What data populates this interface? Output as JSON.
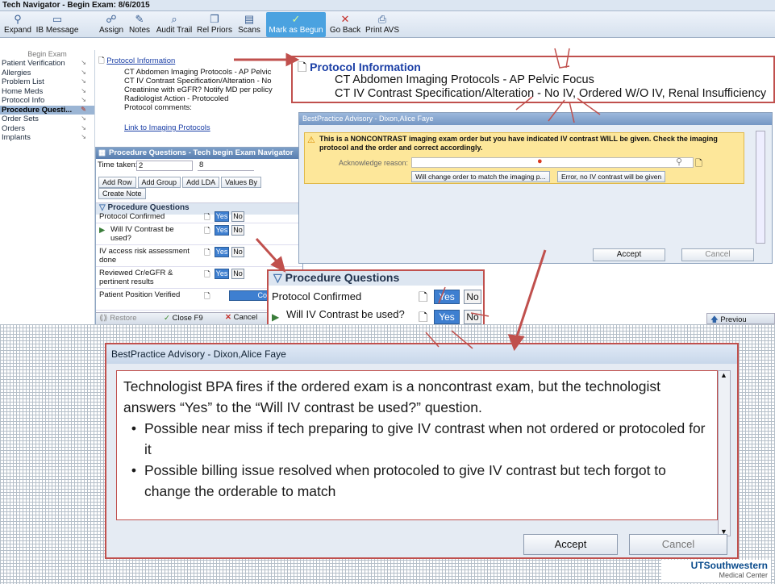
{
  "window": {
    "title": "Tech Navigator - Begin Exam: 8/6/2015"
  },
  "toolbar": {
    "items": [
      {
        "label": "Expand",
        "icon": "magnifier-icon"
      },
      {
        "label": "IB Message",
        "icon": "inbox-icon"
      },
      {
        "label": "Assign",
        "icon": "assign-icon"
      },
      {
        "label": "Notes",
        "icon": "notes-icon"
      },
      {
        "label": "Audit Trail",
        "icon": "audit-icon"
      },
      {
        "label": "Rel Priors",
        "icon": "priors-icon"
      },
      {
        "label": "Scans",
        "icon": "scan-icon"
      },
      {
        "label": "Mark as Begun",
        "icon": "check-icon"
      },
      {
        "label": "Go Back",
        "icon": "x-icon"
      },
      {
        "label": "Print AVS",
        "icon": "printer-icon"
      }
    ]
  },
  "leftnav": {
    "header": "Begin Exam",
    "items": [
      "Patient Verification",
      "Allergies",
      "Problem List",
      "Home Meds",
      "Protocol Info",
      "Procedure Questi...",
      "Order Sets",
      "Orders",
      "Implants"
    ],
    "selected_index": 5
  },
  "protocol": {
    "heading": "Protocol Information",
    "lines": [
      "CT Abdomen Imaging Protocols - AP Pelvic",
      "CT IV Contrast Specification/Alteration - No",
      "Creatinine with eGFR? Notify MD per policy",
      "Radiologist Action - Protocoled",
      "Protocol comments:"
    ],
    "link": "Link to Imaging Protocols"
  },
  "procpanel": {
    "title": "Procedure Questions - Tech begin Exam Navigator",
    "time_label": "Time taken:",
    "time_value_1": "2",
    "time_value_2": "8",
    "buttons": [
      "Add Row",
      "Add Group",
      "Add LDA",
      "Values By",
      "Create Note"
    ],
    "section": "Procedure Questions",
    "questions": [
      {
        "label": "Protocol Confirmed",
        "yes": "Yes",
        "no": "No"
      },
      {
        "label": "Will IV Contrast be used?",
        "yes": "Yes",
        "no": "No"
      },
      {
        "label": "IV access risk assessment done",
        "yes": "Yes",
        "no": "No"
      },
      {
        "label": "Reviewed Cr/eGFR & pertinent results",
        "yes": "Yes",
        "no": "No"
      },
      {
        "label": "Patient Position Verified",
        "extra": "Correct imag"
      }
    ],
    "footer": {
      "restore": "Restore",
      "close": "Close",
      "close_key": "F9",
      "cancel": "Cancel"
    }
  },
  "zoom_protocol": {
    "heading": "Protocol Information",
    "line1": "CT Abdomen Imaging Protocols - AP Pelvic Focus",
    "line2": "CT IV Contrast Specification/Alteration - No IV, Ordered W/O IV, Renal Insufficiency"
  },
  "bpa_small": {
    "title": "BestPractice Advisory - Dixon,Alice Faye",
    "message": "This is a NONCONTRAST imaging exam order but you have indicated IV contrast WILL be given. Check the imaging protocol and the order and correct accordingly.",
    "ack_label": "Acknowledge reason:",
    "option1": "Will change order to match the imaging p...",
    "option2": "Error, no IV contrast will be given",
    "accept": "Accept",
    "cancel": "Cancel"
  },
  "zoom_questions": {
    "section": "Procedure Questions",
    "q1": "Protocol Confirmed",
    "q2": "Will IV Contrast be used?",
    "yes": "Yes",
    "no": "No"
  },
  "previous_label": "Previou",
  "bpa_big": {
    "title": "BestPractice Advisory - Dixon,Alice Faye",
    "paragraph": "Technologist BPA fires if the ordered exam is a noncontrast exam, but the technologist answers “Yes” to the “Will IV contrast be used?” question.",
    "bullets": [
      "Possible near miss if tech preparing to give IV contrast when not ordered or protocoled for it",
      "Possible billing issue resolved when protocoled to give IV contrast but tech forgot to change the orderable to match"
    ],
    "accept": "Accept",
    "cancel": "Cancel"
  },
  "logo": {
    "line1": "UTSouthwestern",
    "line2": "Medical Center"
  },
  "colors": {
    "accent_red": "#c0504d",
    "header_blue": "#587eb0",
    "selected_btn": "#3e7fd0"
  }
}
